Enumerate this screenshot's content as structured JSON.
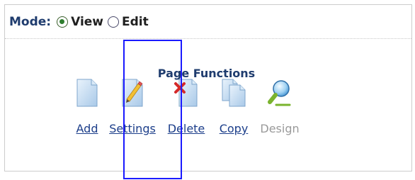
{
  "mode": {
    "label": "Mode:",
    "options": [
      {
        "label": "View",
        "selected": true
      },
      {
        "label": "Edit",
        "selected": false
      }
    ]
  },
  "page_functions": {
    "title": "Page Functions",
    "items": [
      {
        "label": "Add",
        "icon": "page-icon",
        "enabled": true
      },
      {
        "label": "Settings",
        "icon": "page-pencil-icon",
        "enabled": true
      },
      {
        "label": "Delete",
        "icon": "page-delete-icon",
        "enabled": true
      },
      {
        "label": "Copy",
        "icon": "copy-pages-icon",
        "enabled": true
      },
      {
        "label": "Design",
        "icon": "magnifier-icon",
        "enabled": false
      }
    ]
  },
  "colors": {
    "title_text": "#1f3c6e",
    "link": "#1c3e8a",
    "disabled": "#9a9a9a",
    "highlight_box": "#1a1aff"
  }
}
